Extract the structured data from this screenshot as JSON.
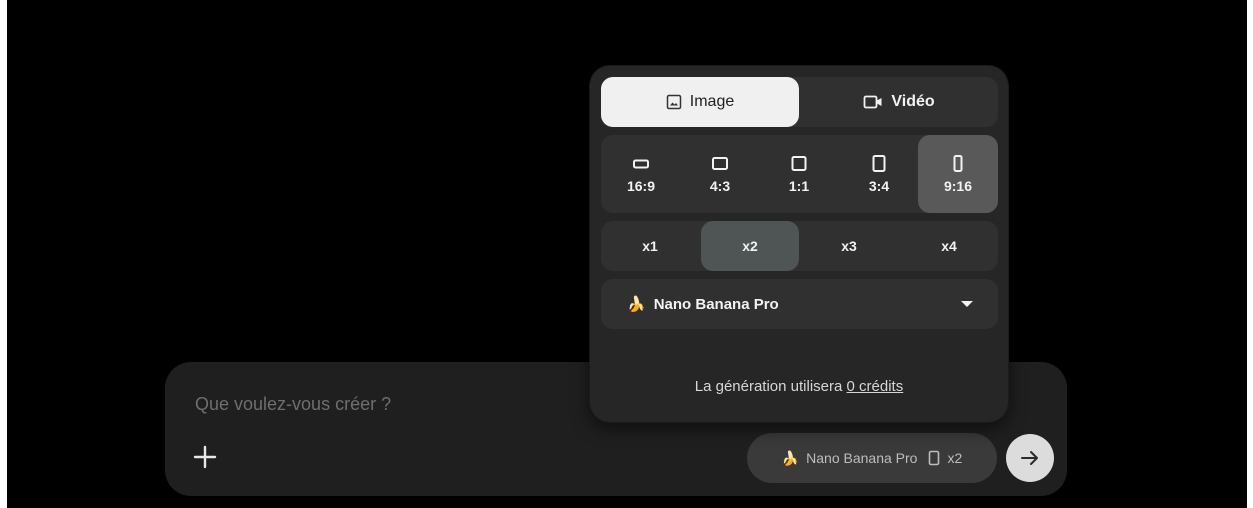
{
  "prompt": {
    "placeholder": "Que voulez-vous créer ?",
    "value": ""
  },
  "mode_tabs": [
    {
      "label": "Image",
      "icon": "image-icon",
      "selected": true
    },
    {
      "label": "Vidéo",
      "icon": "video-camera-icon",
      "selected": false
    }
  ],
  "aspect_ratios": [
    {
      "label": "16:9",
      "selected": false
    },
    {
      "label": "4:3",
      "selected": false
    },
    {
      "label": "1:1",
      "selected": false
    },
    {
      "label": "3:4",
      "selected": false
    },
    {
      "label": "9:16",
      "selected": true
    }
  ],
  "counts": [
    {
      "label": "x1",
      "selected": false
    },
    {
      "label": "x2",
      "selected": true
    },
    {
      "label": "x3",
      "selected": false
    },
    {
      "label": "x4",
      "selected": false
    }
  ],
  "model": {
    "emoji": "🍌",
    "name": "Nano Banana Pro"
  },
  "credits": {
    "prefix": "La génération utilisera",
    "link": "0 crédits"
  },
  "chip": {
    "model": "Nano Banana Pro",
    "count": "x2"
  },
  "colors": {
    "background": "#000000",
    "panel": "#262626",
    "segment": "#303030",
    "selected": "#595959",
    "active_tab": "#f0f0f0"
  }
}
